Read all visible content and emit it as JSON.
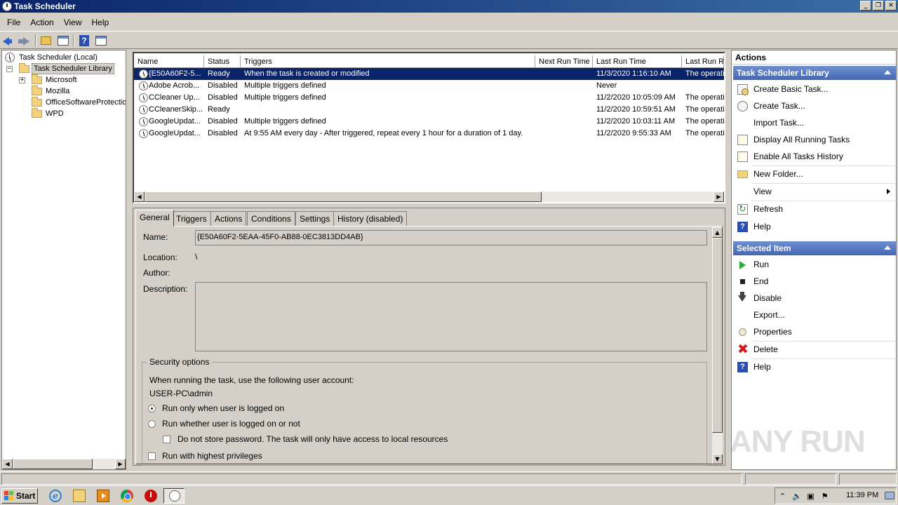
{
  "window": {
    "title": "Task Scheduler",
    "controls": [
      "_",
      "❐",
      "✕"
    ]
  },
  "menu": [
    "File",
    "Action",
    "View",
    "Help"
  ],
  "tree": {
    "root": "Task Scheduler (Local)",
    "library": "Task Scheduler Library",
    "children": [
      "Microsoft",
      "Mozilla",
      "OfficeSoftwareProtectio",
      "WPD"
    ]
  },
  "task_list": {
    "columns": [
      "Name",
      "Status",
      "Triggers",
      "Next Run Time",
      "Last Run Time",
      "Last Run Re"
    ],
    "rows": [
      {
        "name": "{E50A60F2-5...",
        "status": "Ready",
        "triggers": "When the task is created or modified",
        "next_run": "",
        "last_run": "11/3/2020 1:16:10 AM",
        "result": "The operati"
      },
      {
        "name": "Adobe Acrob...",
        "status": "Disabled",
        "triggers": "Multiple triggers defined",
        "next_run": "",
        "last_run": "Never",
        "result": ""
      },
      {
        "name": "CCleaner Up...",
        "status": "Disabled",
        "triggers": "Multiple triggers defined",
        "next_run": "",
        "last_run": "11/2/2020 10:05:09 AM",
        "result": "The operati"
      },
      {
        "name": "CCleanerSkip...",
        "status": "Ready",
        "triggers": "",
        "next_run": "",
        "last_run": "11/2/2020 10:59:51 AM",
        "result": "The operati"
      },
      {
        "name": "GoogleUpdat...",
        "status": "Disabled",
        "triggers": "Multiple triggers defined",
        "next_run": "",
        "last_run": "11/2/2020 10:03:11 AM",
        "result": "The operati"
      },
      {
        "name": "GoogleUpdat...",
        "status": "Disabled",
        "triggers": "At 9:55 AM every day - After triggered, repeat every 1 hour for a duration of 1 day.",
        "next_run": "",
        "last_run": "11/2/2020 9:55:33 AM",
        "result": "The operati"
      }
    ]
  },
  "detail": {
    "tabs": [
      "General",
      "Triggers",
      "Actions",
      "Conditions",
      "Settings",
      "History (disabled)"
    ],
    "name_label": "Name:",
    "name_value": "{E50A60F2-5EAA-45F0-AB88-0EC3813DD4AB}",
    "location_label": "Location:",
    "location_value": "\\",
    "author_label": "Author:",
    "description_label": "Description:",
    "security": {
      "title": "Security options",
      "account_prompt": "When running the task, use the following user account:",
      "account": "USER-PC\\admin",
      "opt_logged_on": "Run only when user is logged on",
      "opt_whether": "Run whether user is logged on or not",
      "opt_no_store": "Do not store password.  The task will only have access to local resources",
      "opt_highest": "Run with highest privileges"
    }
  },
  "actions": {
    "title": "Actions",
    "library_section": {
      "header": "Task Scheduler Library",
      "items": [
        "Create Basic Task...",
        "Create Task...",
        "Import Task...",
        "Display All Running Tasks",
        "Enable All Tasks History",
        "New Folder...",
        "View",
        "Refresh",
        "Help"
      ]
    },
    "selected_section": {
      "header": "Selected Item",
      "items": [
        "Run",
        "End",
        "Disable",
        "Export...",
        "Properties",
        "Delete",
        "Help"
      ]
    }
  },
  "taskbar": {
    "start": "Start",
    "clock": "11:39 PM"
  },
  "watermark": "ANY RUN"
}
